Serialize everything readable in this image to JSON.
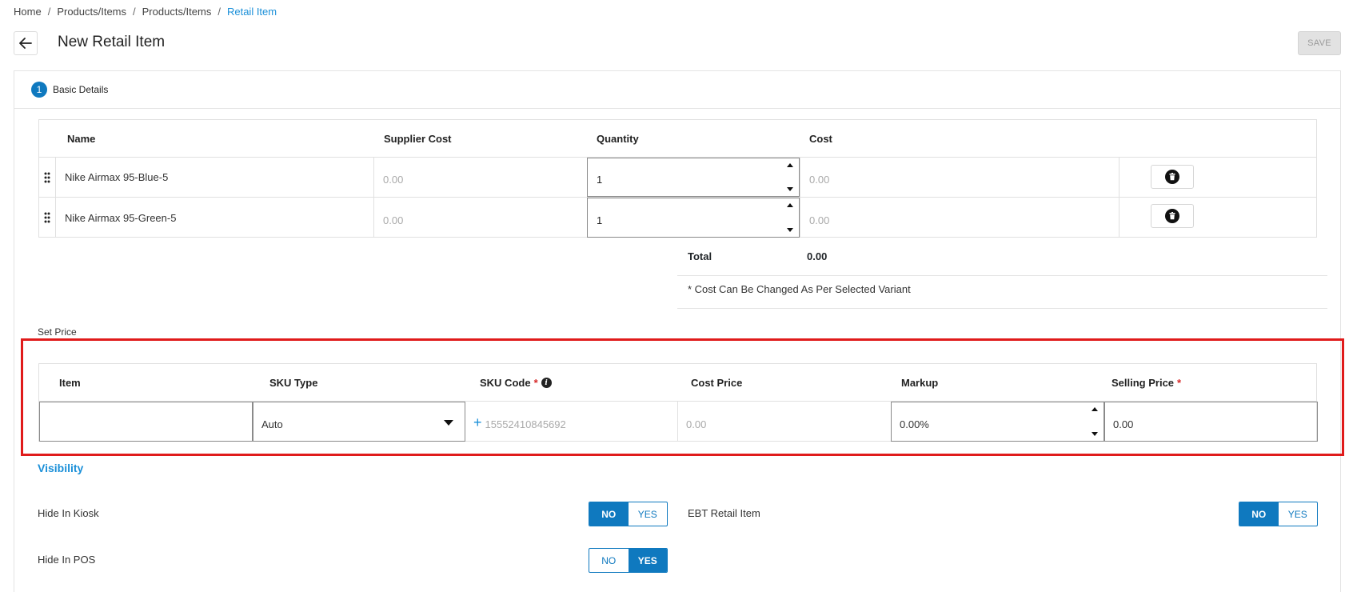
{
  "breadcrumb": [
    "Home",
    "Products/Items",
    "Products/Items",
    "Retail Item"
  ],
  "header": {
    "title": "New Retail Item",
    "save_label": "SAVE"
  },
  "steps": [
    {
      "number": "1",
      "label": "Basic Details"
    }
  ],
  "variants": {
    "columns": {
      "name": "Name",
      "supplier_cost": "Supplier Cost",
      "quantity": "Quantity",
      "cost": "Cost"
    },
    "rows": [
      {
        "name": "Nike Airmax 95-Blue-5",
        "supplier_cost": "0.00",
        "quantity": "1",
        "cost": "0.00"
      },
      {
        "name": "Nike Airmax 95-Green-5",
        "supplier_cost": "0.00",
        "quantity": "1",
        "cost": "0.00"
      }
    ],
    "total_label": "Total",
    "total_value": "0.00",
    "note": "* Cost Can Be Changed As Per Selected Variant"
  },
  "set_price": {
    "label": "Set Price",
    "columns": {
      "item": "Item",
      "sku_type": "SKU Type",
      "sku_code": "SKU Code",
      "cost_price": "Cost Price",
      "markup": "Markup",
      "selling_price": "Selling Price"
    },
    "required_mark": "*",
    "row": {
      "item": "",
      "sku_type": "Auto",
      "sku_code_placeholder": "15552410845692",
      "cost_price": "0.00",
      "markup": "0.00%",
      "selling_price": "0.00"
    }
  },
  "visibility": {
    "title": "Visibility",
    "hide_kiosk": {
      "label": "Hide In Kiosk",
      "no": "NO",
      "yes": "YES",
      "selected": "NO"
    },
    "ebt_retail": {
      "label": "EBT Retail Item",
      "no": "NO",
      "yes": "YES",
      "selected": "NO"
    },
    "hide_pos": {
      "label": "Hide In POS",
      "no": "NO",
      "yes": "YES",
      "selected": "YES"
    }
  },
  "colors": {
    "accent": "#1a8fd8",
    "primary": "#0f79bf",
    "highlight": "#e01b1b",
    "required": "#d62828"
  },
  "icons": {
    "back": "arrow-left-icon",
    "delete": "trash-icon",
    "drag": "drag-handle-icon",
    "info": "info-icon",
    "add": "plus-icon",
    "dropdown": "caret-down-icon"
  }
}
